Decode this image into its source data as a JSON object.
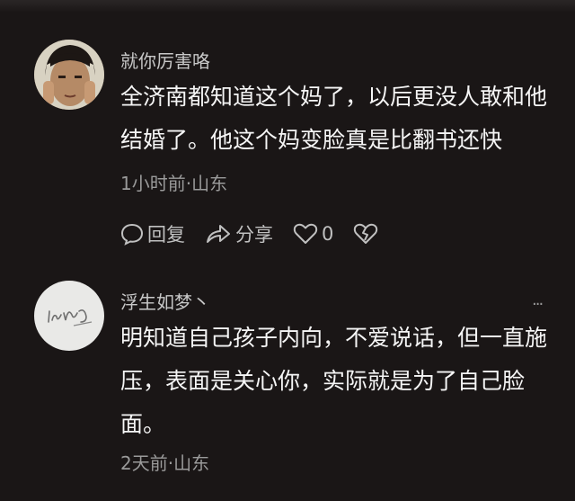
{
  "comments": [
    {
      "username": "就你厉害咯",
      "text": "全济南都知道这个妈了，以后更没人敢和他结婚了。他这个妈变脸真是比翻书还快",
      "meta": "1小时前·山东",
      "actions": {
        "reply": "回复",
        "share": "分享",
        "likes": "0"
      },
      "avatar_icon": "user-avatar-photo"
    },
    {
      "username": "浮生如梦丶",
      "text": "明知道自己孩子内向，不爱说话，但一直施压，表面是关心你，实际就是为了自己脸面。",
      "meta": "2天前·山东",
      "avatar_icon": "user-avatar-signature"
    }
  ],
  "more_label": "···"
}
